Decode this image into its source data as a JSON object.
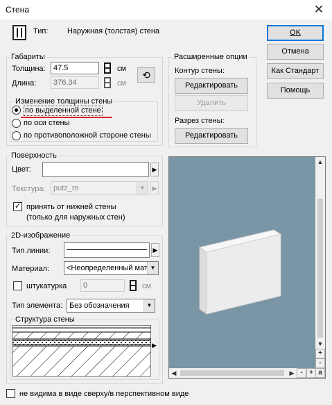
{
  "window": {
    "title": "Стена"
  },
  "header": {
    "type_label": "Тип:",
    "type_value": "Наружная (толстая) стена"
  },
  "buttons": {
    "ok": "OK",
    "cancel": "Отмена",
    "default": "Как Стандарт",
    "help": "Помощь"
  },
  "dimensions": {
    "group_label": "Габариты",
    "thickness_label": "Толщина:",
    "thickness_value": "47.5",
    "thickness_unit": "см",
    "length_label": "Длина:",
    "length_value": "376.34",
    "length_unit": "см"
  },
  "thickness_change": {
    "group_label": "Изменение толщины стены",
    "options": [
      "по выделенной стене",
      "по оси стены",
      "по противоположной стороне стены"
    ],
    "selected_index": 0
  },
  "advanced": {
    "group_label": "Расширенные опции",
    "contour_label": "Контур стены:",
    "edit_button": "Редактировать",
    "delete_button": "Удалить",
    "section_label": "Разрез стены:",
    "edit_button2": "Редактировать"
  },
  "surface": {
    "group_label": "Поверхность",
    "color_label": "Цвет:",
    "texture_label": "Текстура:",
    "texture_value": "putz_m",
    "inherit_label_1": "принять от нижней стены",
    "inherit_label_2": "(только для наружных стен)",
    "inherit_checked": true
  },
  "view2d": {
    "group_label": "2D-изображение",
    "line_type_label": "Тип линии:",
    "material_label": "Материал:",
    "material_value": "<Неопределенный мат",
    "plaster_label": "штукатурка",
    "plaster_value": "0",
    "plaster_unit": "см",
    "plaster_checked": false,
    "element_type_label": "Тип элемента:",
    "element_type_value": "Без обозначения",
    "structure_label": "Структура стены"
  },
  "preview": {
    "zoom_in": "+",
    "zoom_out": "-",
    "auto": "a"
  },
  "footer": {
    "hidden_label": "не видима в виде сверху/в перспективном виде",
    "hidden_checked": false
  },
  "colors": {
    "accent": "#0078d7",
    "preview_bg": "#7a95a6",
    "underline": "#e0202a"
  }
}
